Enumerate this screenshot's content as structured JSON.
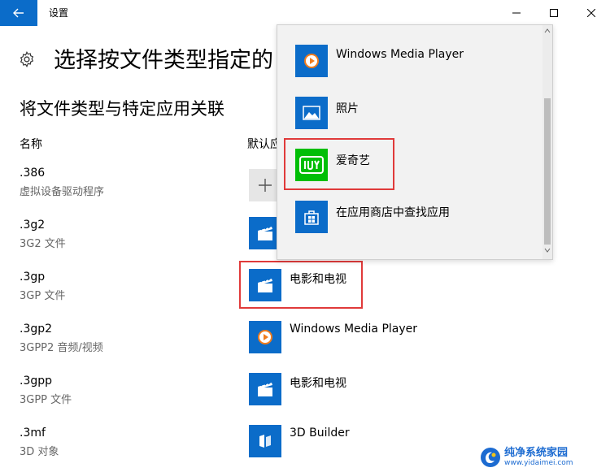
{
  "window": {
    "title": "设置"
  },
  "header": {
    "page_title": "选择按文件类型指定的",
    "section_title": "将文件类型与特定应用关联",
    "col_name": "名称",
    "col_default": "默认应"
  },
  "rows": [
    {
      "ext": ".386",
      "desc": "虚拟设备驱动程序",
      "app": "",
      "icon": "plus-icon"
    },
    {
      "ext": ".3g2",
      "desc": "3G2 文件",
      "app": "",
      "icon": "film-icon"
    },
    {
      "ext": ".3gp",
      "desc": "3GP 文件",
      "app": "电影和电视",
      "icon": "film-icon"
    },
    {
      "ext": ".3gp2",
      "desc": "3GPP2 音频/视频",
      "app": "Windows Media Player",
      "icon": "media-player-icon"
    },
    {
      "ext": ".3gpp",
      "desc": "3GPP 文件",
      "app": "电影和电视",
      "icon": "film-icon"
    },
    {
      "ext": ".3mf",
      "desc": "3D 对象",
      "app": "3D Builder",
      "icon": "3d-builder-icon"
    }
  ],
  "flyout": {
    "items": [
      {
        "label": "Windows Media Player",
        "icon": "media-player-icon"
      },
      {
        "label": "照片",
        "icon": "photos-icon"
      },
      {
        "label": "爱奇艺",
        "icon": "iqiyi-icon"
      },
      {
        "label": "在应用商店中查找应用",
        "icon": "store-icon"
      }
    ]
  },
  "watermark": {
    "main": "纯净系统家园",
    "sub": "www.yidaimei.com"
  },
  "colors": {
    "accent": "#0b6cc9",
    "highlight": "#e03a3a",
    "iqiyi": "#00be06"
  }
}
